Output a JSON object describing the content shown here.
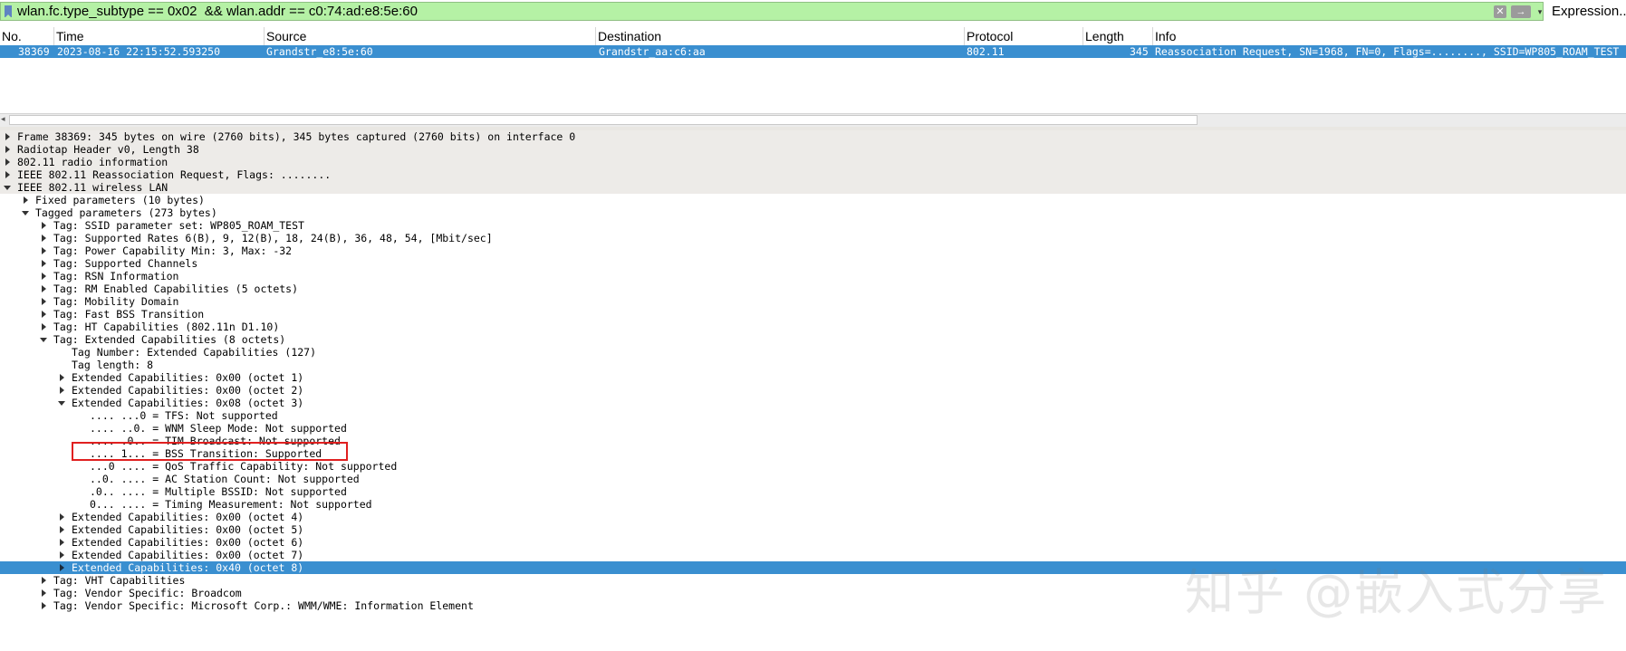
{
  "filter": {
    "value": "wlan.fc.type_subtype == 0x02  && wlan.addr == c0:74:ad:e8:5e:60",
    "clear_icon": "✕",
    "apply_icon": "→",
    "menu_icon": "▾",
    "expression_label": "Expression..."
  },
  "packet_list": {
    "columns": [
      "No.",
      "Time",
      "Source",
      "Destination",
      "Protocol",
      "Length",
      "Info"
    ],
    "rows": [
      {
        "no": "38369",
        "time": "2023-08-16 22:15:52.593250",
        "source": "Grandstr_e8:5e:60",
        "destination": "Grandstr_aa:c6:aa",
        "protocol": "802.11",
        "length": "345",
        "info": "Reassociation Request, SN=1968, FN=0, Flags=........, SSID=WP805_ROAM_TEST"
      }
    ]
  },
  "details": [
    {
      "text": "Frame 38369: 345 bytes on wire (2760 bits), 345 bytes captured (2760 bits) on interface 0",
      "level": 0,
      "expander": "right",
      "shaded": true
    },
    {
      "text": "Radiotap Header v0, Length 38",
      "level": 0,
      "expander": "right",
      "shaded": true
    },
    {
      "text": "802.11 radio information",
      "level": 0,
      "expander": "right",
      "shaded": true
    },
    {
      "text": "IEEE 802.11 Reassociation Request, Flags: ........",
      "level": 0,
      "expander": "right",
      "shaded": true
    },
    {
      "text": "IEEE 802.11 wireless LAN",
      "level": 0,
      "expander": "down",
      "shaded": true
    },
    {
      "text": "Fixed parameters (10 bytes)",
      "level": 1,
      "expander": "right"
    },
    {
      "text": "Tagged parameters (273 bytes)",
      "level": 1,
      "expander": "down"
    },
    {
      "text": "Tag: SSID parameter set: WP805_ROAM_TEST",
      "level": 2,
      "expander": "right"
    },
    {
      "text": "Tag: Supported Rates 6(B), 9, 12(B), 18, 24(B), 36, 48, 54, [Mbit/sec]",
      "level": 2,
      "expander": "right"
    },
    {
      "text": "Tag: Power Capability Min: 3, Max: -32",
      "level": 2,
      "expander": "right"
    },
    {
      "text": "Tag: Supported Channels",
      "level": 2,
      "expander": "right"
    },
    {
      "text": "Tag: RSN Information",
      "level": 2,
      "expander": "right"
    },
    {
      "text": "Tag: RM Enabled Capabilities (5 octets)",
      "level": 2,
      "expander": "right"
    },
    {
      "text": "Tag: Mobility Domain",
      "level": 2,
      "expander": "right"
    },
    {
      "text": "Tag: Fast BSS Transition",
      "level": 2,
      "expander": "right"
    },
    {
      "text": "Tag: HT Capabilities (802.11n D1.10)",
      "level": 2,
      "expander": "right"
    },
    {
      "text": "Tag: Extended Capabilities (8 octets)",
      "level": 2,
      "expander": "down"
    },
    {
      "text": "Tag Number: Extended Capabilities (127)",
      "level": 3,
      "expander": "none"
    },
    {
      "text": "Tag length: 8",
      "level": 3,
      "expander": "none"
    },
    {
      "text": "Extended Capabilities: 0x00 (octet 1)",
      "level": 3,
      "expander": "right"
    },
    {
      "text": "Extended Capabilities: 0x00 (octet 2)",
      "level": 3,
      "expander": "right"
    },
    {
      "text": "Extended Capabilities: 0x08 (octet 3)",
      "level": 3,
      "expander": "down"
    },
    {
      "text": ".... ...0 = TFS: Not supported",
      "level": 4,
      "expander": "none"
    },
    {
      "text": ".... ..0. = WNM Sleep Mode: Not supported",
      "level": 4,
      "expander": "none"
    },
    {
      "text": ".... .0.. = TIM Broadcast: Not supported",
      "level": 4,
      "expander": "none"
    },
    {
      "text": ".... 1... = BSS Transition: Supported",
      "level": 4,
      "expander": "none",
      "highlighted": true
    },
    {
      "text": "...0 .... = QoS Traffic Capability: Not supported",
      "level": 4,
      "expander": "none"
    },
    {
      "text": "..0. .... = AC Station Count: Not supported",
      "level": 4,
      "expander": "none"
    },
    {
      "text": ".0.. .... = Multiple BSSID: Not supported",
      "level": 4,
      "expander": "none"
    },
    {
      "text": "0... .... = Timing Measurement: Not supported",
      "level": 4,
      "expander": "none"
    },
    {
      "text": "Extended Capabilities: 0x00 (octet 4)",
      "level": 3,
      "expander": "right"
    },
    {
      "text": "Extended Capabilities: 0x00 (octet 5)",
      "level": 3,
      "expander": "right"
    },
    {
      "text": "Extended Capabilities: 0x00 (octet 6)",
      "level": 3,
      "expander": "right"
    },
    {
      "text": "Extended Capabilities: 0x00 (octet 7)",
      "level": 3,
      "expander": "right"
    },
    {
      "text": "Extended Capabilities: 0x40 (octet 8)",
      "level": 3,
      "expander": "right",
      "selected": true
    },
    {
      "text": "Tag: VHT Capabilities",
      "level": 2,
      "expander": "right"
    },
    {
      "text": "Tag: Vendor Specific: Broadcom",
      "level": 2,
      "expander": "right"
    },
    {
      "text": "Tag: Vendor Specific: Microsoft Corp.: WMM/WME: Information Element",
      "level": 2,
      "expander": "right"
    }
  ],
  "watermark": "知乎 @嵌入式分享",
  "colors": {
    "filter_valid": "#b5f1a5",
    "selection": "#3a8fd0",
    "highlight_box": "#e02020"
  }
}
